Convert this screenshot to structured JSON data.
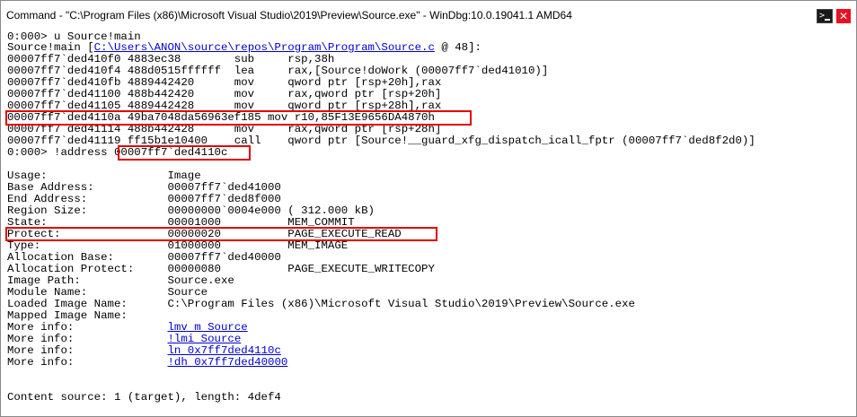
{
  "window": {
    "title": "Command - \"C:\\Program Files (x86)\\Microsoft Visual Studio\\2019\\Preview\\Source.exe\" - WinDbg:10.0.19041.1 AMD64",
    "cmd_icon": "command-prompt-icon",
    "close_glyph": "✕"
  },
  "console": {
    "l0": "0:000> u Source!main",
    "l1_pre": "Source!main [",
    "l1_link": "C:\\Users\\ANON\\source\\repos\\Program\\Program\\Source.c",
    "l1_post": " @ 48]:",
    "l2": "00007ff7`ded410f0 4883ec38        sub     rsp,38h",
    "l3": "00007ff7`ded410f4 488d0515ffffff  lea     rax,[Source!doWork (00007ff7`ded41010)]",
    "l4": "00007ff7`ded410fb 4889442420      mov     qword ptr [rsp+20h],rax",
    "l5": "00007ff7`ded41100 488b442420      mov     rax,qword ptr [rsp+20h]",
    "l6": "00007ff7`ded41105 4889442428      mov     qword ptr [rsp+28h],rax",
    "l7": "00007ff7`ded4110a 49ba7048da56963ef185 mov r10,85F13E9656DA4870h",
    "l8": "00007ff7`ded41114 488b442428      mov     rax,qword ptr [rsp+28h]",
    "l9": "00007ff7`ded41119 ff15b1e10400    call    qword ptr [Source!__guard_xfg_dispatch_icall_fptr (00007ff7`ded8f2d0)]",
    "l10": "0:000> !address 00007ff7`ded4110c",
    "l11": "",
    "l12": "",
    "l13": "Usage:                  Image",
    "l14": "Base Address:           00007ff7`ded41000",
    "l15": "End Address:            00007ff7`ded8f000",
    "l16": "Region Size:            00000000`0004e000 ( 312.000 kB)",
    "l17": "State:                  00001000          MEM_COMMIT",
    "l18": "Protect:                00000020          PAGE_EXECUTE_READ",
    "l19": "Type:                   01000000          MEM_IMAGE",
    "l20": "Allocation Base:        00007ff7`ded40000",
    "l21": "Allocation Protect:     00000080          PAGE_EXECUTE_WRITECOPY",
    "l22": "Image Path:             Source.exe",
    "l23": "Module Name:            Source",
    "l24": "Loaded Image Name:      C:\\Program Files (x86)\\Microsoft Visual Studio\\2019\\Preview\\Source.exe",
    "l25": "Mapped Image Name:",
    "l26_pre": "More info:              ",
    "l26_link": "lmv m Source",
    "l27_pre": "More info:              ",
    "l27_link": "!lmi Source",
    "l28_pre": "More info:              ",
    "l28_link": "ln 0x7ff7ded4110c",
    "l29_pre": "More info:              ",
    "l29_link": "!dh 0x7ff7ded40000",
    "l30": "",
    "l31": "",
    "l32": "Content source: 1 (target), length: 4def4"
  },
  "colors": {
    "highlight": "#e00000",
    "link": "#0000cc",
    "close": "#e81123"
  }
}
